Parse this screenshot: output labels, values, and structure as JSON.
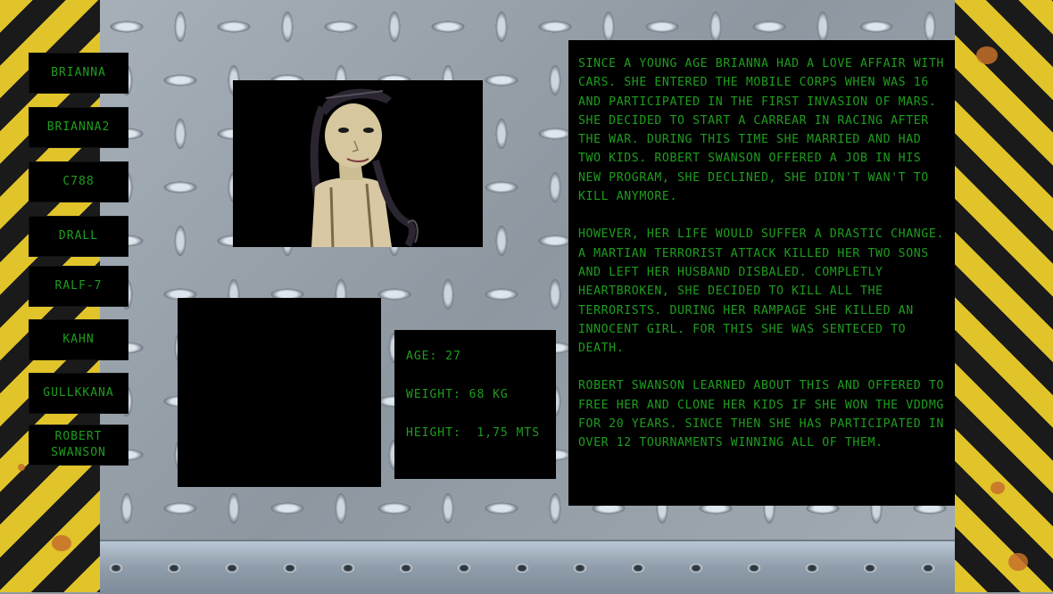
{
  "characters": [
    "BRIANNA",
    "BRIANNA2",
    "C788",
    "DRALL",
    "RALF-7",
    "KAHN",
    "GULLKKANA",
    "ROBERT SWANSON"
  ],
  "stats": {
    "age": "AGE: 27",
    "weight": "WEIGHT: 68 KG",
    "height": "HEIGHT:  1,75 MTS"
  },
  "bio": [
    "SINCE A YOUNG AGE BRIANNA HAD A LOVE AFFAIR WITH CARS. SHE ENTERED THE MOBILE CORPS WHEN WAS  16 AND PARTICIPATED IN THE FIRST INVASION OF MARS. SHE DECIDED TO START A CARREAR IN RACING AFTER THE WAR. DURING THIS TIME SHE MARRIED AND HAD TWO KIDS. ROBERT SWANSON OFFERED A JOB IN HIS NEW PROGRAM, SHE DECLINED, SHE DIDN'T WAN'T TO KILL ANYMORE.",
    "HOWEVER, HER LIFE WOULD SUFFER A DRASTIC CHANGE. A MARTIAN TERRORIST ATTACK KILLED HER TWO SONS AND LEFT HER HUSBAND DISBALED. COMPLETLY HEARTBROKEN, SHE DECIDED TO KILL ALL THE TERRORISTS. DURING HER RAMPAGE SHE KILLED AN INNOCENT GIRL. FOR THIS SHE WAS SENTECED TO DEATH.",
    "ROBERT SWANSON LEARNED ABOUT THIS AND OFFERED TO FREE HER AND CLONE HER KIDS IF SHE WON THE VDDMG FOR 20 YEARS. SINCE THEN SHE HAS PARTICIPATED IN OVER  12 TOURNAMENTS WINNING ALL OF THEM."
  ],
  "colors": {
    "text_green": "#1f9d1f",
    "hazard_yellow": "#e0c42a",
    "panel_black": "#000000"
  }
}
